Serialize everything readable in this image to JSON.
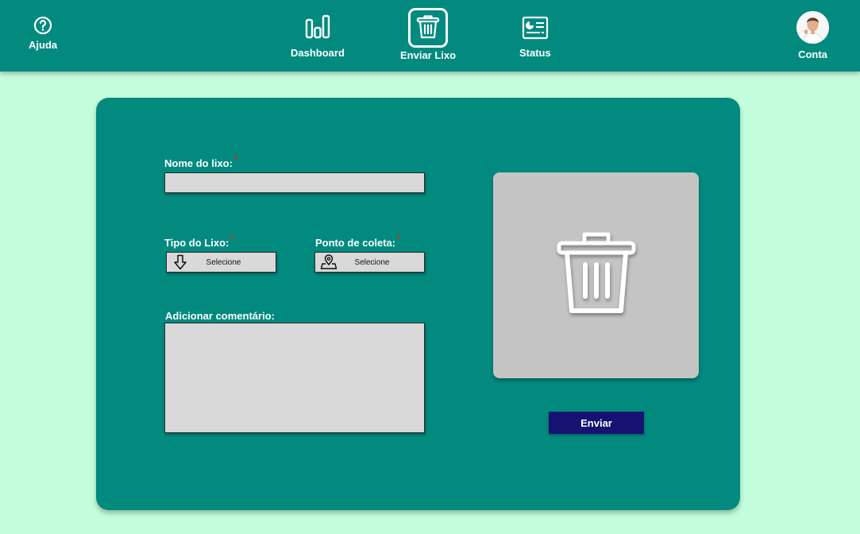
{
  "nav": {
    "help_label": "Ajuda",
    "dashboard_label": "Dashboard",
    "enviar_label": "Enviar Lixo",
    "status_label": "Status",
    "account_label": "Conta"
  },
  "form": {
    "name_label": "Nome do lixo:",
    "name_value": "",
    "type_label": "Tipo do Lixo:",
    "type_value": "Selecione",
    "point_label": "Ponto de coleta:",
    "point_value": "Selecione",
    "comment_label": "Adicionar comentário:",
    "comment_value": "",
    "required_mark": "*",
    "submit_label": "Enviar"
  },
  "colors": {
    "page_bg": "#c3fddb",
    "primary": "#028a7f",
    "input_bg": "#d9d9d9",
    "button": "#151272",
    "required": "#e02424",
    "image_placeholder": "#c4c4c4"
  },
  "icons": {
    "help": "question-circle-icon",
    "dashboard": "bar-chart-icon",
    "enviar": "trash-icon",
    "status": "status-card-icon",
    "type_select": "arrow-down-icon",
    "point_select": "location-pin-icon",
    "image": "trash-icon"
  }
}
